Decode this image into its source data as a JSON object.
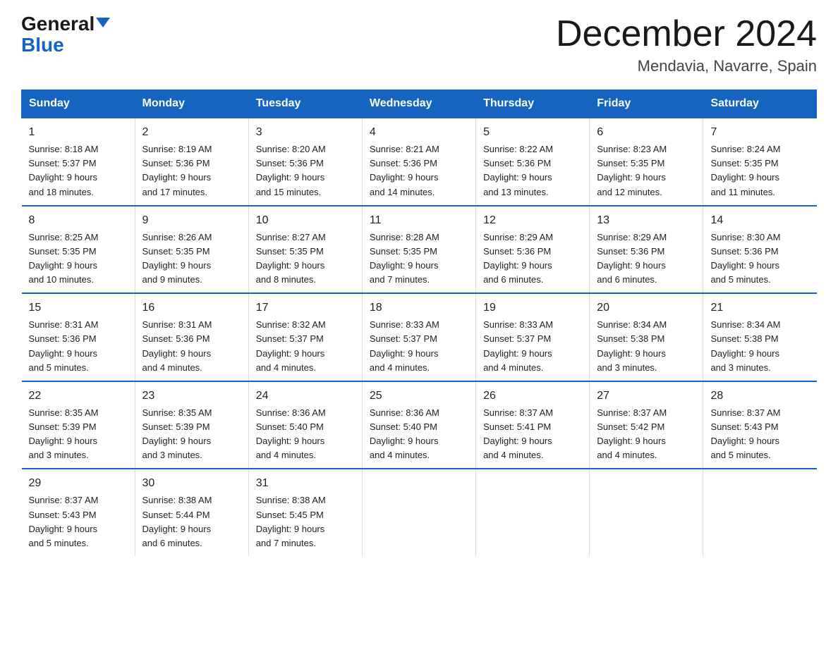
{
  "logo": {
    "general": "General",
    "blue": "Blue",
    "triangle": "▶"
  },
  "title": "December 2024",
  "location": "Mendavia, Navarre, Spain",
  "weekdays": [
    "Sunday",
    "Monday",
    "Tuesday",
    "Wednesday",
    "Thursday",
    "Friday",
    "Saturday"
  ],
  "weeks": [
    [
      {
        "day": "1",
        "info": "Sunrise: 8:18 AM\nSunset: 5:37 PM\nDaylight: 9 hours\nand 18 minutes."
      },
      {
        "day": "2",
        "info": "Sunrise: 8:19 AM\nSunset: 5:36 PM\nDaylight: 9 hours\nand 17 minutes."
      },
      {
        "day": "3",
        "info": "Sunrise: 8:20 AM\nSunset: 5:36 PM\nDaylight: 9 hours\nand 15 minutes."
      },
      {
        "day": "4",
        "info": "Sunrise: 8:21 AM\nSunset: 5:36 PM\nDaylight: 9 hours\nand 14 minutes."
      },
      {
        "day": "5",
        "info": "Sunrise: 8:22 AM\nSunset: 5:36 PM\nDaylight: 9 hours\nand 13 minutes."
      },
      {
        "day": "6",
        "info": "Sunrise: 8:23 AM\nSunset: 5:35 PM\nDaylight: 9 hours\nand 12 minutes."
      },
      {
        "day": "7",
        "info": "Sunrise: 8:24 AM\nSunset: 5:35 PM\nDaylight: 9 hours\nand 11 minutes."
      }
    ],
    [
      {
        "day": "8",
        "info": "Sunrise: 8:25 AM\nSunset: 5:35 PM\nDaylight: 9 hours\nand 10 minutes."
      },
      {
        "day": "9",
        "info": "Sunrise: 8:26 AM\nSunset: 5:35 PM\nDaylight: 9 hours\nand 9 minutes."
      },
      {
        "day": "10",
        "info": "Sunrise: 8:27 AM\nSunset: 5:35 PM\nDaylight: 9 hours\nand 8 minutes."
      },
      {
        "day": "11",
        "info": "Sunrise: 8:28 AM\nSunset: 5:35 PM\nDaylight: 9 hours\nand 7 minutes."
      },
      {
        "day": "12",
        "info": "Sunrise: 8:29 AM\nSunset: 5:36 PM\nDaylight: 9 hours\nand 6 minutes."
      },
      {
        "day": "13",
        "info": "Sunrise: 8:29 AM\nSunset: 5:36 PM\nDaylight: 9 hours\nand 6 minutes."
      },
      {
        "day": "14",
        "info": "Sunrise: 8:30 AM\nSunset: 5:36 PM\nDaylight: 9 hours\nand 5 minutes."
      }
    ],
    [
      {
        "day": "15",
        "info": "Sunrise: 8:31 AM\nSunset: 5:36 PM\nDaylight: 9 hours\nand 5 minutes."
      },
      {
        "day": "16",
        "info": "Sunrise: 8:31 AM\nSunset: 5:36 PM\nDaylight: 9 hours\nand 4 minutes."
      },
      {
        "day": "17",
        "info": "Sunrise: 8:32 AM\nSunset: 5:37 PM\nDaylight: 9 hours\nand 4 minutes."
      },
      {
        "day": "18",
        "info": "Sunrise: 8:33 AM\nSunset: 5:37 PM\nDaylight: 9 hours\nand 4 minutes."
      },
      {
        "day": "19",
        "info": "Sunrise: 8:33 AM\nSunset: 5:37 PM\nDaylight: 9 hours\nand 4 minutes."
      },
      {
        "day": "20",
        "info": "Sunrise: 8:34 AM\nSunset: 5:38 PM\nDaylight: 9 hours\nand 3 minutes."
      },
      {
        "day": "21",
        "info": "Sunrise: 8:34 AM\nSunset: 5:38 PM\nDaylight: 9 hours\nand 3 minutes."
      }
    ],
    [
      {
        "day": "22",
        "info": "Sunrise: 8:35 AM\nSunset: 5:39 PM\nDaylight: 9 hours\nand 3 minutes."
      },
      {
        "day": "23",
        "info": "Sunrise: 8:35 AM\nSunset: 5:39 PM\nDaylight: 9 hours\nand 3 minutes."
      },
      {
        "day": "24",
        "info": "Sunrise: 8:36 AM\nSunset: 5:40 PM\nDaylight: 9 hours\nand 4 minutes."
      },
      {
        "day": "25",
        "info": "Sunrise: 8:36 AM\nSunset: 5:40 PM\nDaylight: 9 hours\nand 4 minutes."
      },
      {
        "day": "26",
        "info": "Sunrise: 8:37 AM\nSunset: 5:41 PM\nDaylight: 9 hours\nand 4 minutes."
      },
      {
        "day": "27",
        "info": "Sunrise: 8:37 AM\nSunset: 5:42 PM\nDaylight: 9 hours\nand 4 minutes."
      },
      {
        "day": "28",
        "info": "Sunrise: 8:37 AM\nSunset: 5:43 PM\nDaylight: 9 hours\nand 5 minutes."
      }
    ],
    [
      {
        "day": "29",
        "info": "Sunrise: 8:37 AM\nSunset: 5:43 PM\nDaylight: 9 hours\nand 5 minutes."
      },
      {
        "day": "30",
        "info": "Sunrise: 8:38 AM\nSunset: 5:44 PM\nDaylight: 9 hours\nand 6 minutes."
      },
      {
        "day": "31",
        "info": "Sunrise: 8:38 AM\nSunset: 5:45 PM\nDaylight: 9 hours\nand 7 minutes."
      },
      {
        "day": "",
        "info": ""
      },
      {
        "day": "",
        "info": ""
      },
      {
        "day": "",
        "info": ""
      },
      {
        "day": "",
        "info": ""
      }
    ]
  ]
}
